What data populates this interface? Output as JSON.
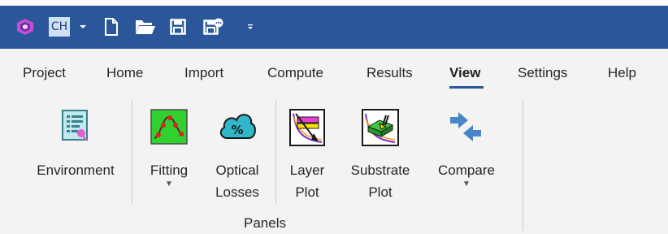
{
  "quick_access": {
    "app_icon": "app-logo-icon",
    "doc_badge": "CH",
    "badge_dropdown_icon": "caret-down-icon",
    "new_icon": "new-document-icon",
    "open_icon": "folder-open-icon",
    "save_icon": "save-icon",
    "save_as_icon": "save-as-icon",
    "customize_icon": "customize-dropdown-icon"
  },
  "tabs": [
    {
      "label": "Project"
    },
    {
      "label": "Home"
    },
    {
      "label": "Import"
    },
    {
      "label": "Compute"
    },
    {
      "label": "Results"
    },
    {
      "label": "View",
      "active": true
    },
    {
      "label": "Settings"
    },
    {
      "label": "Help"
    }
  ],
  "ribbon": {
    "buttons": {
      "environment": {
        "line1": "Environment",
        "line2": "",
        "icon": "environment-icon"
      },
      "fitting": {
        "line1": "Fitting",
        "line2": "",
        "icon": "fitting-icon",
        "has_dropdown": true
      },
      "optical_losses": {
        "line1": "Optical",
        "line2": "Losses",
        "icon": "optical-losses-icon"
      },
      "layer_plot": {
        "line1": "Layer",
        "line2": "Plot",
        "icon": "layer-plot-icon"
      },
      "substrate_plot": {
        "line1": "Substrate",
        "line2": "Plot",
        "icon": "substrate-plot-icon"
      },
      "compare": {
        "line1": "Compare",
        "line2": "",
        "icon": "compare-icon",
        "has_dropdown": true
      }
    },
    "group_label": "Panels"
  },
  "colors": {
    "title_bar": "#2b579a",
    "ribbon_bg": "#f3f3f3",
    "accent": "#2b579a"
  }
}
